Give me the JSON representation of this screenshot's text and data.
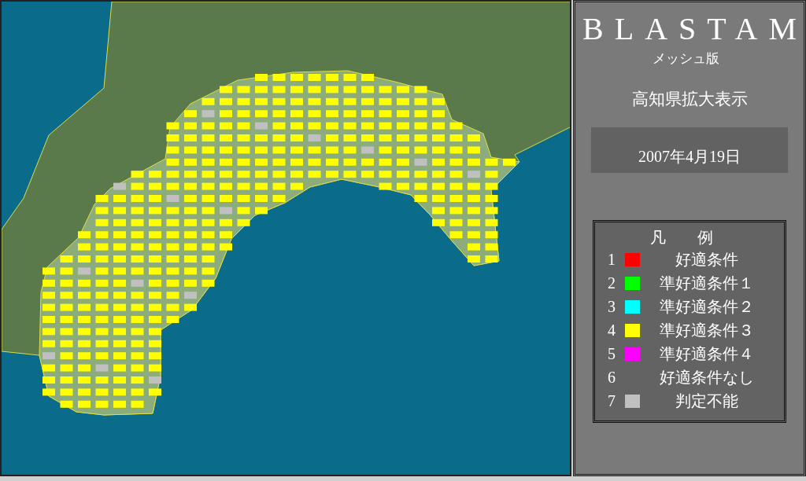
{
  "app": {
    "title": "BLASTAM",
    "subtitle": "メッシュ版"
  },
  "view_label": "高知県拡大表示",
  "date": "2007年4月19日",
  "legend": {
    "title": "凡　　例",
    "items": [
      {
        "number": "1",
        "color": "#ff0000",
        "label": "好適条件"
      },
      {
        "number": "2",
        "color": "#00ff00",
        "label": "準好適条件１"
      },
      {
        "number": "3",
        "color": "#00ffff",
        "label": "準好適条件２"
      },
      {
        "number": "4",
        "color": "#ffff00",
        "label": "準好適条件３"
      },
      {
        "number": "5",
        "color": "#ff00ff",
        "label": "準好適条件４"
      },
      {
        "number": "6",
        "label": "好適条件なし"
      },
      {
        "number": "7",
        "color": "#c0c0c0",
        "label": "判定不能"
      }
    ]
  }
}
